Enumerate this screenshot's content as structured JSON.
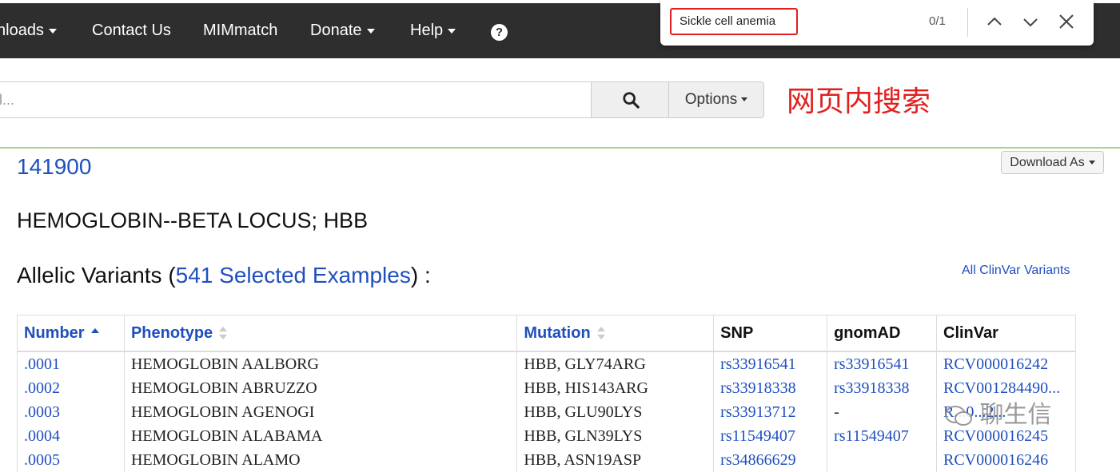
{
  "nav": {
    "items": [
      {
        "label": "nloads",
        "dropdown": true
      },
      {
        "label": "Contact Us",
        "dropdown": false
      },
      {
        "label": "MIMmatch",
        "dropdown": false
      },
      {
        "label": "Donate",
        "dropdown": true
      },
      {
        "label": "Help",
        "dropdown": true
      }
    ],
    "help_icon": "question-circle-icon",
    "help_glyph": "?"
  },
  "find_bar": {
    "query": "Sickle cell anemia",
    "count": "0/1"
  },
  "search": {
    "placeholder": "l...",
    "options_label": "Options"
  },
  "annotation": "网页内搜索",
  "entry": {
    "number": "141900",
    "title": "HEMOGLOBIN--BETA LOCUS; HBB",
    "download_label": "Download As"
  },
  "variants_section": {
    "title_prefix": "Allelic Variants (",
    "link_text": "541 Selected Examples",
    "title_suffix": ") :",
    "all_clinvar_label": "All ClinVar Variants"
  },
  "table": {
    "headers": [
      "Number",
      "Phenotype",
      "Mutation",
      "SNP",
      "gnomAD",
      "ClinVar"
    ],
    "rows": [
      {
        "number": ".0001",
        "phenotype": "HEMOGLOBIN AALBORG",
        "mutation": "HBB, GLY74ARG",
        "snp": "rs33916541",
        "gnomad": "rs33916541",
        "clinvar": "RCV000016242"
      },
      {
        "number": ".0002",
        "phenotype": "HEMOGLOBIN ABRUZZO",
        "mutation": "HBB, HIS143ARG",
        "snp": "rs33918338",
        "gnomad": "rs33918338",
        "clinvar": "RCV001284490..."
      },
      {
        "number": ".0003",
        "phenotype": "HEMOGLOBIN AGENOGI",
        "mutation": "HBB, GLU90LYS",
        "snp": "rs33913712",
        "gnomad": "-",
        "clinvar": "R...0...2..."
      },
      {
        "number": ".0004",
        "phenotype": "HEMOGLOBIN ALABAMA",
        "mutation": "HBB, GLN39LYS",
        "snp": "rs11549407",
        "gnomad": "rs11549407",
        "clinvar": "RCV000016245"
      },
      {
        "number": ".0005",
        "phenotype": "HEMOGLOBIN ALAMO",
        "mutation": "HBB, ASN19ASP",
        "snp": "rs34866629",
        "gnomad": "",
        "clinvar": "RCV000016246"
      }
    ]
  },
  "watermark": "聊生信",
  "colors": {
    "link": "#1f4fbf",
    "navbar": "#2e2e2e",
    "annotation": "#e02020",
    "divider": "#a9d28c"
  }
}
